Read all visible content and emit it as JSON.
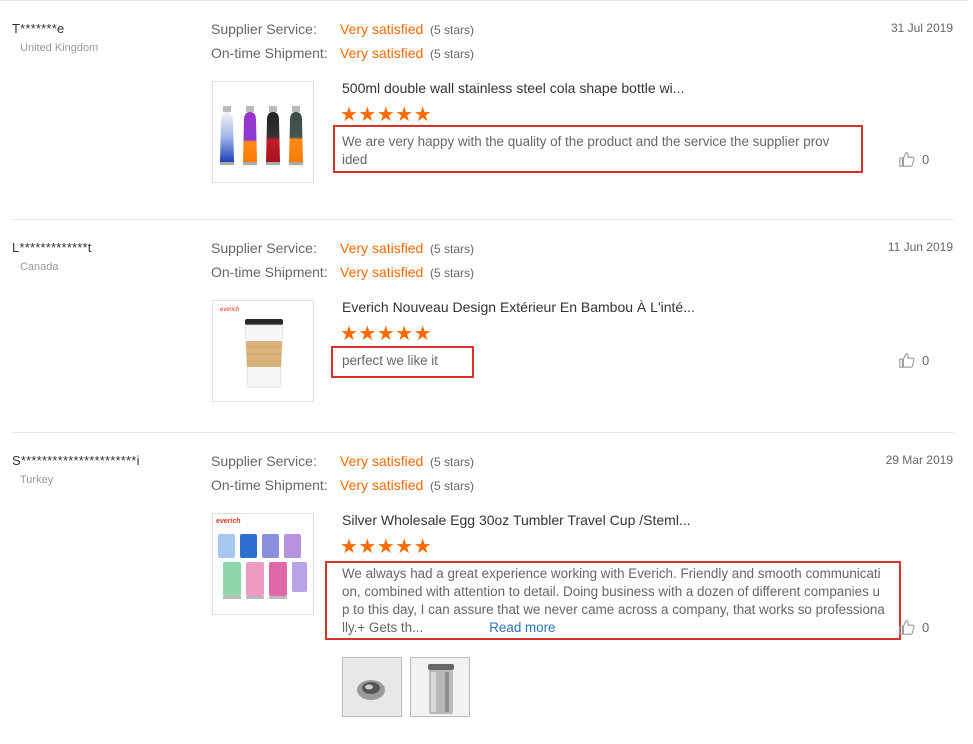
{
  "labels": {
    "supplier_service": "Supplier Service:",
    "ontime_shipment": "On-time Shipment:"
  },
  "reviews": [
    {
      "buyer": "T*******e",
      "country": "United Kingdom",
      "supplier_rating": "Very satisfied",
      "supplier_stars": "(5 stars)",
      "shipment_rating": "Very satisfied",
      "shipment_stars": "(5 stars)",
      "date": "31 Jul 2019",
      "product_title": "500ml double wall stainless steel cola shape bottle wi...",
      "stars": "★★★★★",
      "comment_line1": "We are very happy with the quality of the product and the service the supplier prov",
      "comment_line2": "ided",
      "likes": "0"
    },
    {
      "buyer": "L*************t",
      "country": "Canada",
      "supplier_rating": "Very satisfied",
      "supplier_stars": "(5 stars)",
      "shipment_rating": "Very satisfied",
      "shipment_stars": "(5 stars)",
      "date": "11 Jun 2019",
      "product_title": "Everich Nouveau Design Extérieur En Bambou À L'inté...",
      "stars": "★★★★★",
      "comment_line1": "perfect we like it",
      "likes": "0"
    },
    {
      "buyer": "S**********************i",
      "country": "Turkey",
      "supplier_rating": "Very satisfied",
      "supplier_stars": "(5 stars)",
      "shipment_rating": "Very satisfied",
      "shipment_stars": "(5 stars)",
      "date": "29 Mar 2019",
      "product_title": "Silver Wholesale Egg 30oz Tumbler Travel Cup /Steml...",
      "stars": "★★★★★",
      "comment_line1": "We always had a great experience working with Everich. Friendly and smooth communicati",
      "comment_line2": "on, combined with attention to detail. Doing business with a dozen of different companies u",
      "comment_line3": "p to this day, I can assure that we never came across a company, that works so professiona",
      "comment_line4": "lly.+ Gets th...",
      "read_more": "Read more",
      "likes": "0"
    }
  ],
  "brand_text": "everich",
  "colors": {
    "accent": "#ff6a00",
    "highlight": "#d9302c",
    "link": "#2a73b8"
  },
  "icons": {
    "like": "thumbs-up-icon",
    "star": "star-icon"
  }
}
